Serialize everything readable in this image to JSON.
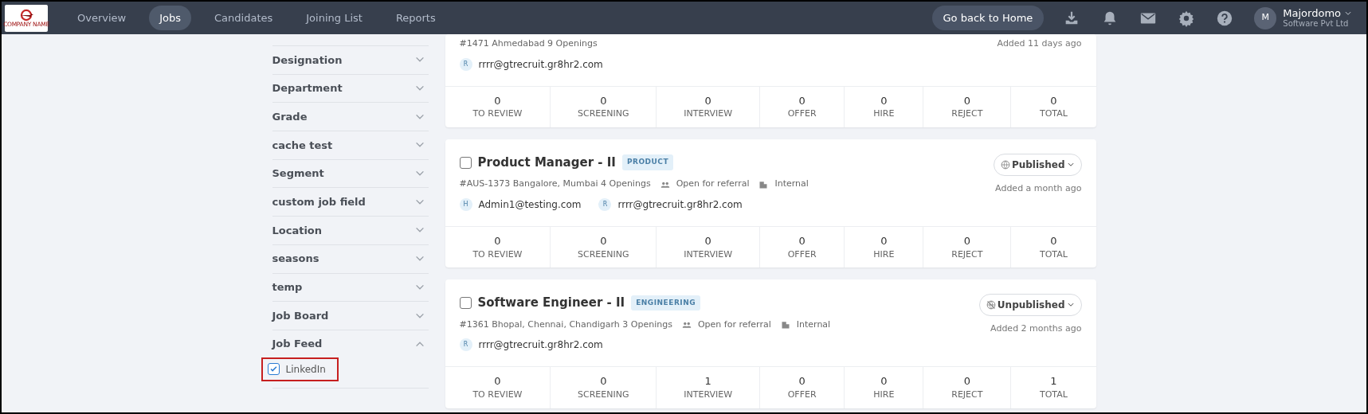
{
  "navbar": {
    "logo_text": "COMPANY NAME",
    "tabs": [
      {
        "label": "Overview",
        "selected": false
      },
      {
        "label": "Jobs",
        "selected": true
      },
      {
        "label": "Candidates",
        "selected": false
      },
      {
        "label": "Joining List",
        "selected": false
      },
      {
        "label": "Reports",
        "selected": false
      }
    ],
    "home_button": "Go back to Home",
    "user": {
      "initial": "M",
      "name": "Majordomo",
      "org": "Software Pvt Ltd"
    }
  },
  "sidebar": {
    "filters": [
      {
        "label": "Designation",
        "expanded": false
      },
      {
        "label": "Department",
        "expanded": false
      },
      {
        "label": "Grade",
        "expanded": false
      },
      {
        "label": "cache test",
        "expanded": false
      },
      {
        "label": "Segment",
        "expanded": false
      },
      {
        "label": "custom job field",
        "expanded": false
      },
      {
        "label": "Location",
        "expanded": false
      },
      {
        "label": "seasons",
        "expanded": false
      },
      {
        "label": "temp",
        "expanded": false
      },
      {
        "label": "Job Board",
        "expanded": false
      },
      {
        "label": "Job Feed",
        "expanded": true,
        "options": [
          {
            "label": "LinkedIn",
            "checked": true,
            "highlighted": true
          }
        ]
      }
    ]
  },
  "jobs": [
    {
      "meta": "#1471  Ahmedabad 9 Openings",
      "added": "Added 11 days ago",
      "recruiters": [
        {
          "initial": "R",
          "email": "rrrr@gtrecruit.gr8hr2.com"
        }
      ],
      "stages": [
        {
          "count": "0",
          "label": "TO REVIEW"
        },
        {
          "count": "0",
          "label": "SCREENING"
        },
        {
          "count": "0",
          "label": "INTERVIEW"
        },
        {
          "count": "0",
          "label": "OFFER"
        },
        {
          "count": "0",
          "label": "HIRE"
        },
        {
          "count": "0",
          "label": "REJECT"
        },
        {
          "count": "0",
          "label": "TOTAL"
        }
      ]
    },
    {
      "checked": false,
      "title": "Product Manager - II",
      "tag": "PRODUCT",
      "meta": "#AUS-1373  Bangalore, Mumbai 4 Openings",
      "referral": "Open for referral",
      "visibility": "Internal",
      "status": {
        "label": "Published",
        "published": true
      },
      "added": "Added a month ago",
      "recruiters": [
        {
          "initial": "H",
          "email": "Admin1@testing.com"
        },
        {
          "initial": "R",
          "email": "rrrr@gtrecruit.gr8hr2.com"
        }
      ],
      "stages": [
        {
          "count": "0",
          "label": "TO REVIEW"
        },
        {
          "count": "0",
          "label": "SCREENING"
        },
        {
          "count": "0",
          "label": "INTERVIEW"
        },
        {
          "count": "0",
          "label": "OFFER"
        },
        {
          "count": "0",
          "label": "HIRE"
        },
        {
          "count": "0",
          "label": "REJECT"
        },
        {
          "count": "0",
          "label": "TOTAL"
        }
      ]
    },
    {
      "checked": false,
      "title": "Software Engineer - II",
      "tag": "ENGINEERING",
      "meta": "#1361  Bhopal, Chennai, Chandigarh 3 Openings",
      "referral": "Open for referral",
      "visibility": "Internal",
      "status": {
        "label": "Unpublished",
        "published": false
      },
      "added": "Added 2 months ago",
      "recruiters": [
        {
          "initial": "R",
          "email": "rrrr@gtrecruit.gr8hr2.com"
        }
      ],
      "stages": [
        {
          "count": "0",
          "label": "TO REVIEW"
        },
        {
          "count": "0",
          "label": "SCREENING"
        },
        {
          "count": "1",
          "label": "INTERVIEW"
        },
        {
          "count": "0",
          "label": "OFFER"
        },
        {
          "count": "0",
          "label": "HIRE"
        },
        {
          "count": "0",
          "label": "REJECT"
        },
        {
          "count": "1",
          "label": "TOTAL"
        }
      ]
    }
  ]
}
